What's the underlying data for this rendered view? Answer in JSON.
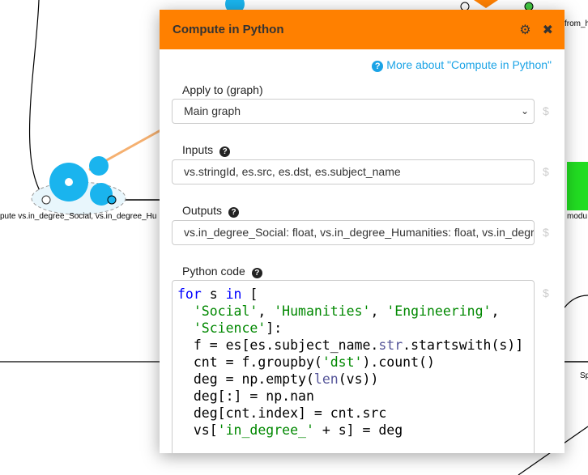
{
  "canvas": {
    "labels": [
      "pute vs.in_degree_Social, vs.in_degree_Hu",
      "from_h",
      "modu",
      "Sp"
    ]
  },
  "popup": {
    "title": "Compute in Python",
    "icons": [
      "gear-icon",
      "close-icon"
    ],
    "help_link": "More about \"Compute in Python\"",
    "apply_to": {
      "label": "Apply to (graph)",
      "value": "Main graph"
    },
    "inputs": {
      "label": "Inputs",
      "value": "vs.stringId, es.src, es.dst, es.subject_name"
    },
    "outputs": {
      "label": "Outputs",
      "value": "vs.in_degree_Social: float, vs.in_degree_Humanities: float, vs.in_degree_Engineering: float, vs.in_degree_Science: float"
    },
    "code": {
      "label": "Python code",
      "lines": [
        "for s in [",
        "  'Social', 'Humanities', 'Engineering',",
        "  'Science']:",
        "  f = es[es.subject_name.str.startswith(s)]",
        "  cnt = f.groupby('dst').count()",
        "  deg = np.empty(len(vs))",
        "  deg[:] = np.nan",
        "  deg[cnt.index] = cnt.src",
        "  vs['in_degree_' + s] = deg"
      ]
    },
    "dollar": "$",
    "accent": "#ff8000",
    "link_color": "#1aa3e6"
  }
}
